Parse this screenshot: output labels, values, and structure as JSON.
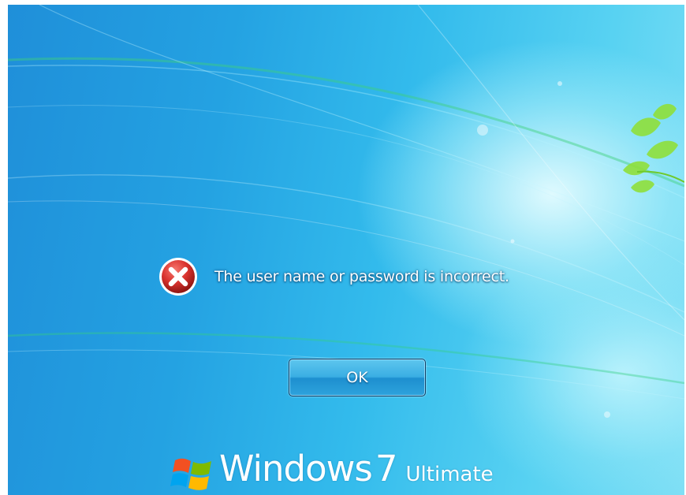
{
  "error": {
    "icon": "error-x-icon",
    "message": "The user name or password is incorrect."
  },
  "ok_button": {
    "label": "OK"
  },
  "branding": {
    "logo_icon": "windows-flag-icon",
    "product": "Windows",
    "version": "7",
    "edition": "Ultimate"
  },
  "colors": {
    "background": "#24a2e2",
    "error_red": "#d9322e",
    "button_border": "#123d63",
    "text": "#ffffff"
  }
}
